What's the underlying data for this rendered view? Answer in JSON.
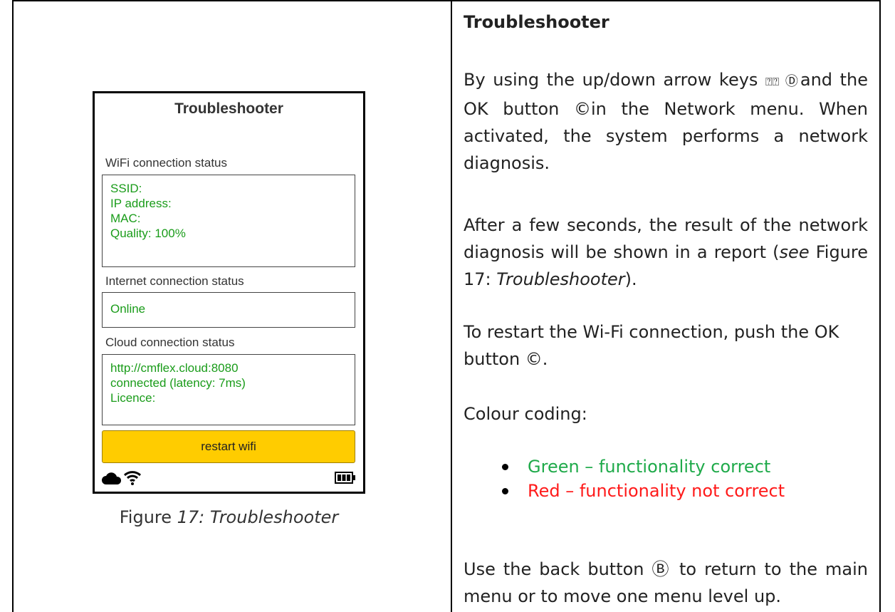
{
  "device": {
    "title": "Troubleshooter",
    "wifi": {
      "label": "WiFi connection status",
      "lines": [
        "SSID:",
        "IP address:",
        "MAC:",
        "Quality: 100%"
      ]
    },
    "internet": {
      "label": "Internet connection status",
      "lines": [
        "Online"
      ]
    },
    "cloud": {
      "label": "Cloud connection status",
      "lines": [
        "http://cmflex.cloud:8080",
        "connected (latency: 7ms)",
        "Licence:"
      ]
    },
    "restart_button": "restart wifi",
    "status_icons": [
      "cloud-icon",
      "wifi-icon",
      "battery-icon"
    ]
  },
  "caption": {
    "prefix": "Figure ",
    "italic": "17: Troubleshooter"
  },
  "text": {
    "heading": "Troubleshooter",
    "para1_a": "By using the up/down arrow keys ",
    "para1_glyph1": "⍰⍰",
    "para1_glyph2": " Ⓓ",
    "para1_b": "and the OK button ©in the Network menu. When activated, the system performs a network diagnosis.",
    "para2_a": "After a few seconds, the result of the network diagnosis will be shown in a report (",
    "para2_see": "see",
    "para2_b": " Figure 17: ",
    "para2_italic": "Troubleshooter",
    "para2_c": ").",
    "para3": "To restart the Wi-Fi connection, push the OK button ©.",
    "para4": "Colour coding:",
    "bullets": [
      {
        "text": "Green – functionality correct",
        "color": "#1faa4a"
      },
      {
        "text": "Red – functionality not correct",
        "color": "#ff1a1a"
      }
    ],
    "para5": "Use the back button Ⓑ to return to the main menu or to move one menu level up."
  }
}
